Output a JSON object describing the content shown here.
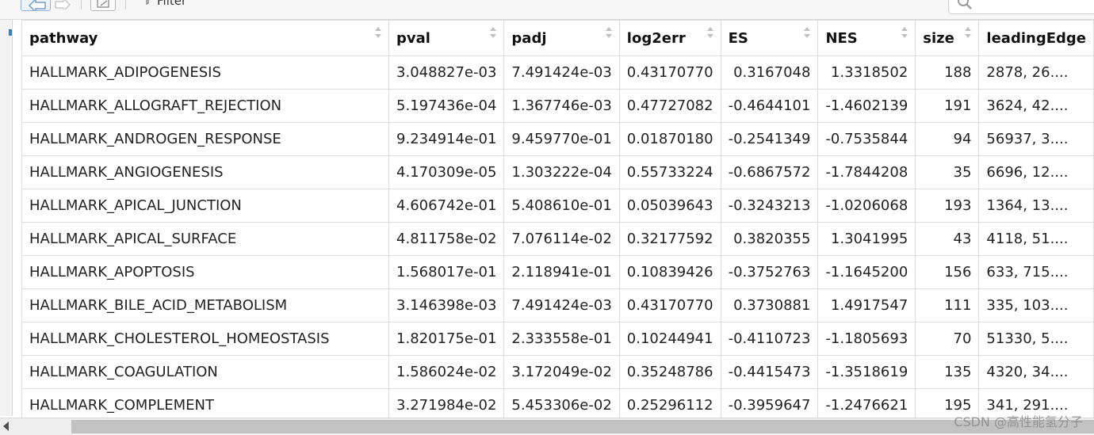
{
  "toolbar": {
    "filter_label": "Filter",
    "search_value": ""
  },
  "columns": [
    "pathway",
    "pval",
    "padj",
    "log2err",
    "ES",
    "NES",
    "size",
    "leadingEdge"
  ],
  "rows": [
    [
      "HALLMARK_ADIPOGENESIS",
      "3.048827e-03",
      "7.491424e-03",
      "0.43170770",
      "0.3167048",
      "1.3318502",
      "188",
      "2878, 26...."
    ],
    [
      "HALLMARK_ALLOGRAFT_REJECTION",
      "5.197436e-04",
      "1.367746e-03",
      "0.47727082",
      "-0.4644101",
      "-1.4602139",
      "191",
      "3624, 42...."
    ],
    [
      "HALLMARK_ANDROGEN_RESPONSE",
      "9.234914e-01",
      "9.459770e-01",
      "0.01870180",
      "-0.2541349",
      "-0.7535844",
      "94",
      "56937, 3...."
    ],
    [
      "HALLMARK_ANGIOGENESIS",
      "4.170309e-05",
      "1.303222e-04",
      "0.55733224",
      "-0.6867572",
      "-1.7844208",
      "35",
      "6696, 12...."
    ],
    [
      "HALLMARK_APICAL_JUNCTION",
      "4.606742e-01",
      "5.408610e-01",
      "0.05039643",
      "-0.3243213",
      "-1.0206068",
      "193",
      "1364, 13...."
    ],
    [
      "HALLMARK_APICAL_SURFACE",
      "4.811758e-02",
      "7.076114e-02",
      "0.32177592",
      "0.3820355",
      "1.3041995",
      "43",
      "4118, 51...."
    ],
    [
      "HALLMARK_APOPTOSIS",
      "1.568017e-01",
      "2.118941e-01",
      "0.10839426",
      "-0.3752763",
      "-1.1645200",
      "156",
      "633, 715...."
    ],
    [
      "HALLMARK_BILE_ACID_METABOLISM",
      "3.146398e-03",
      "7.491424e-03",
      "0.43170770",
      "0.3730881",
      "1.4917547",
      "111",
      "335, 103...."
    ],
    [
      "HALLMARK_CHOLESTEROL_HOMEOSTASIS",
      "1.820175e-01",
      "2.333558e-01",
      "0.10244941",
      "-0.4110723",
      "-1.1805693",
      "70",
      "51330, 5...."
    ],
    [
      "HALLMARK_COAGULATION",
      "1.586024e-02",
      "3.172049e-02",
      "0.35248786",
      "-0.4415473",
      "-1.3518619",
      "135",
      "4320, 34...."
    ],
    [
      "HALLMARK_COMPLEMENT",
      "3.271984e-02",
      "5.453306e-02",
      "0.25296112",
      "-0.3959647",
      "-1.2476621",
      "195",
      "341, 291...."
    ]
  ],
  "watermark": "CSDN @高性能氢分子",
  "colors": {
    "header_border": "#dcdcdc",
    "scroll_thumb": "#c2c2c2",
    "accent": "#3a7fc1"
  }
}
